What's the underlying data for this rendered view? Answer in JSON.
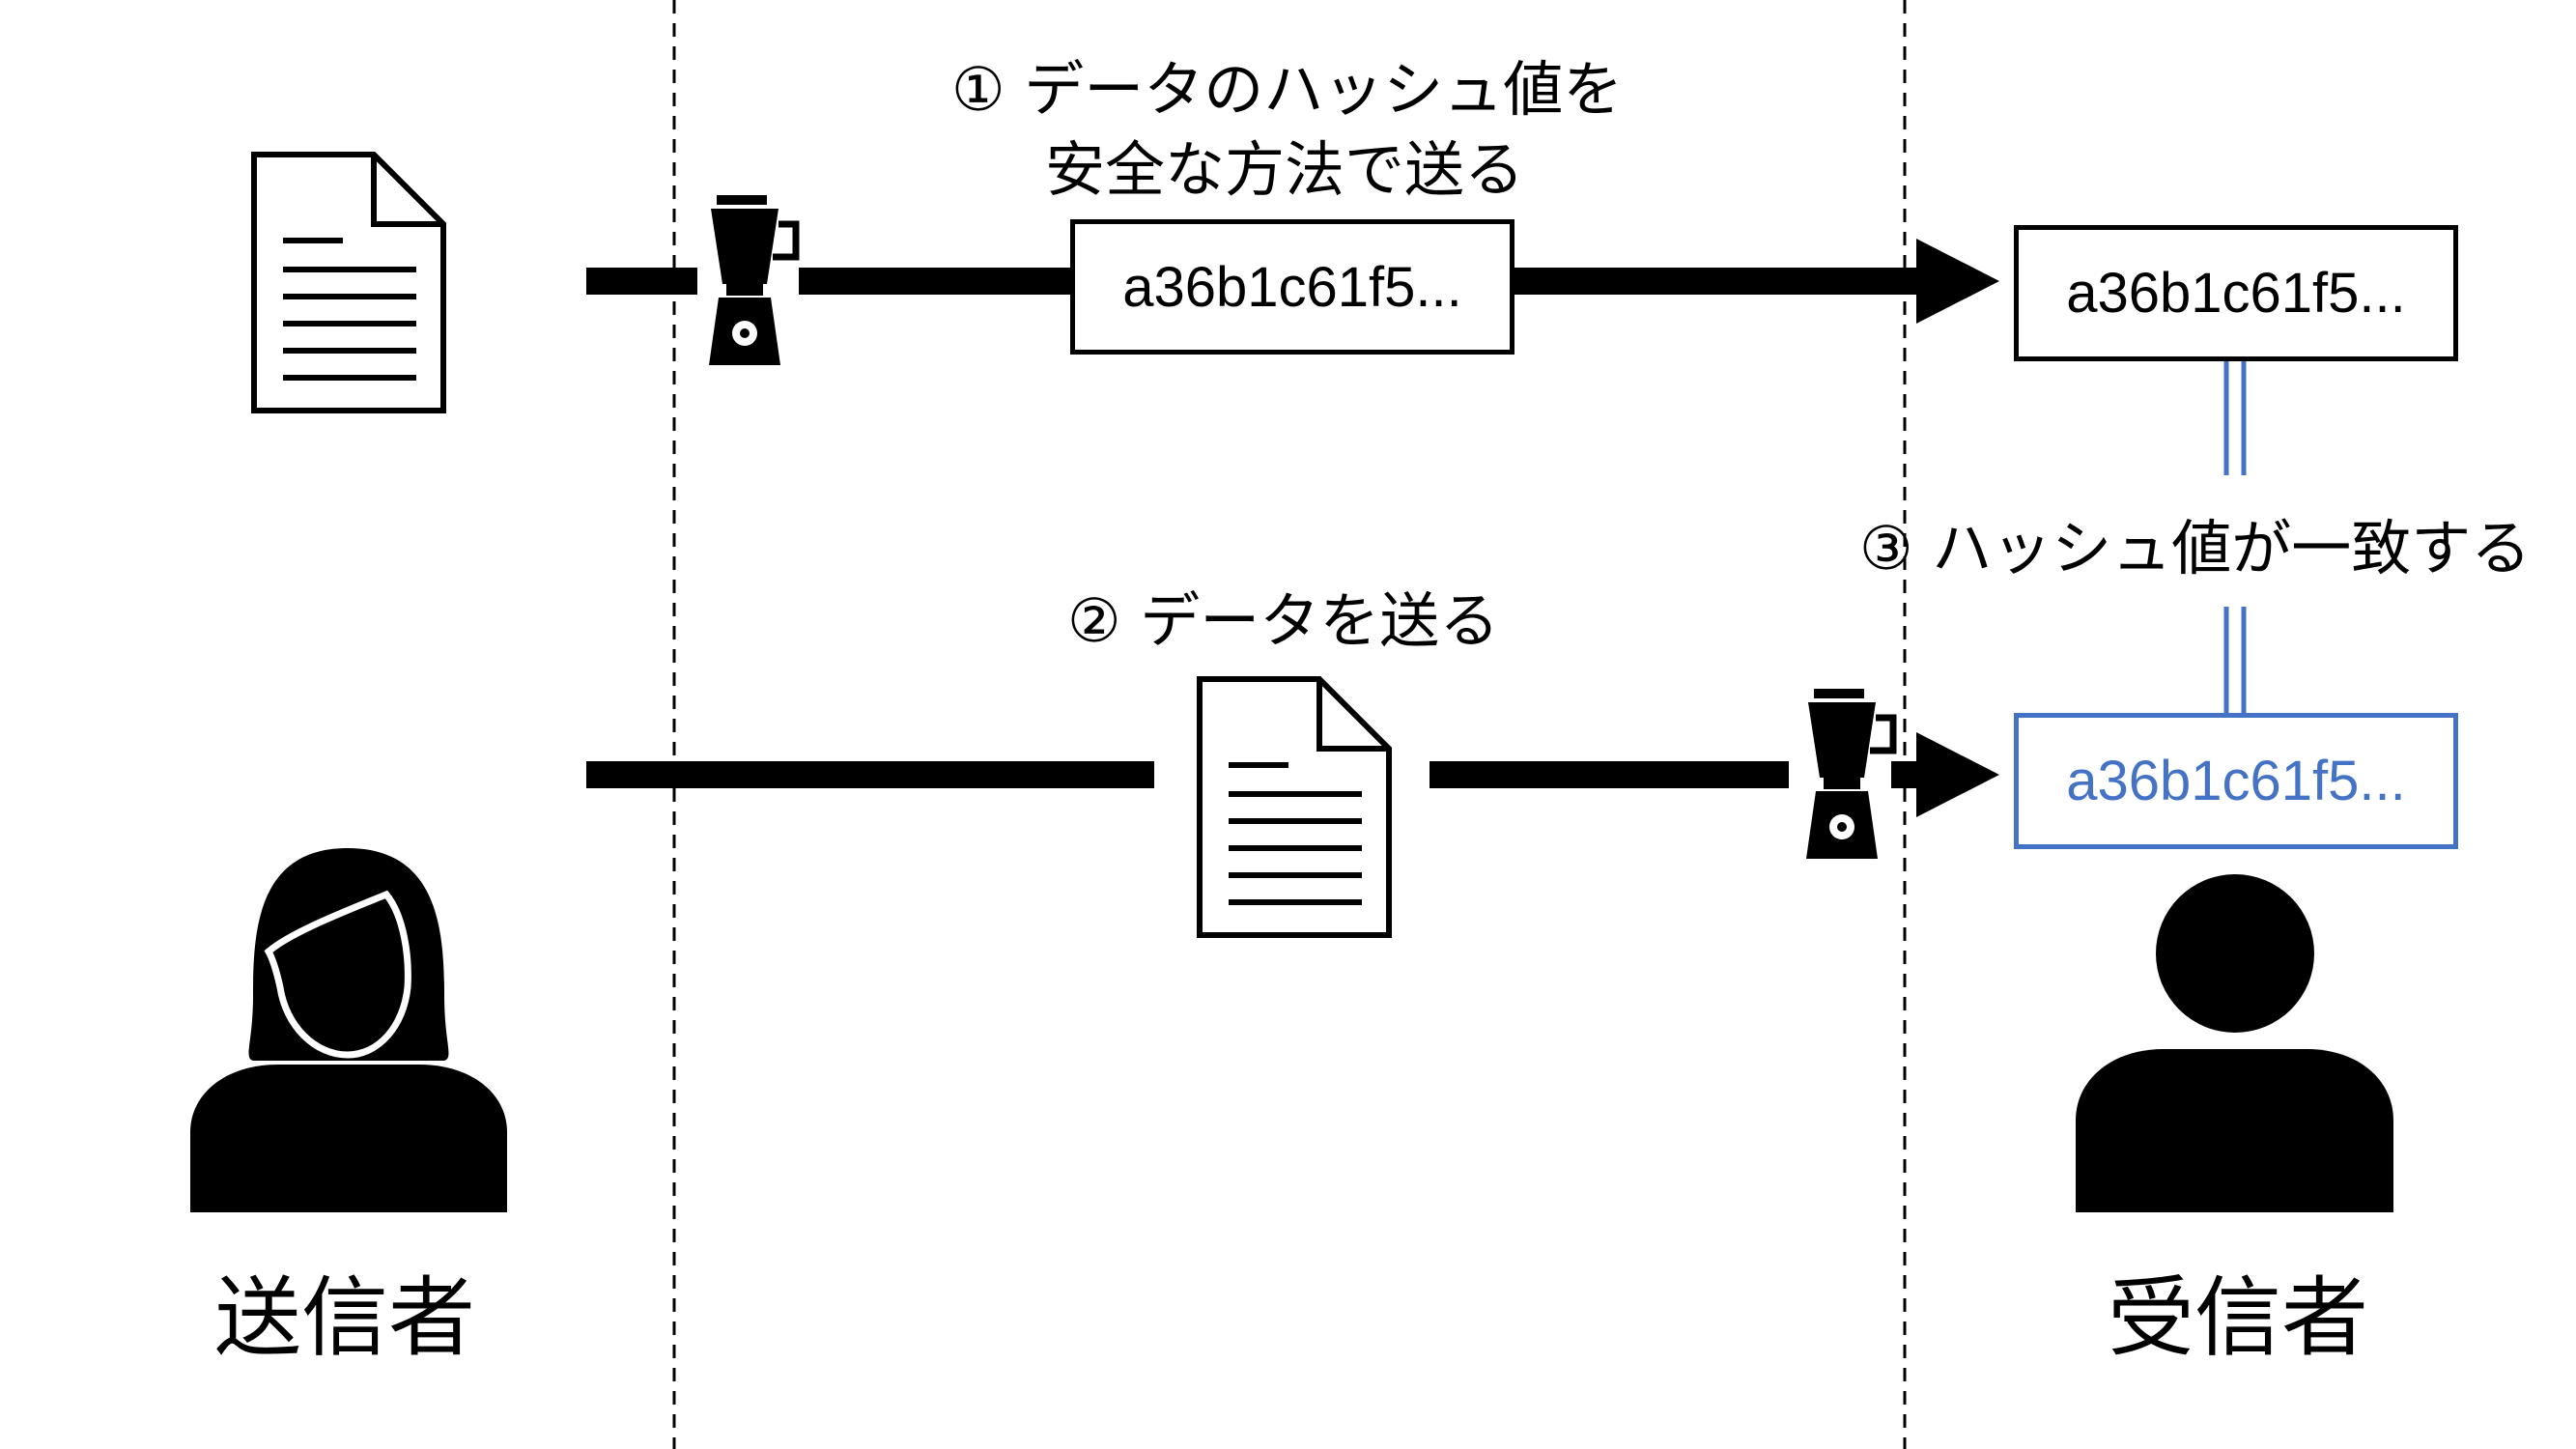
{
  "steps": {
    "step1_line1": "① データのハッシュ値を",
    "step1_line2": "安全な方法で送る",
    "step2": "② データを送る",
    "step3": "③ ハッシュ値が一致する"
  },
  "roles": {
    "sender": "送信者",
    "receiver": "受信者"
  },
  "hashes": {
    "sent_hash": "a36b1c61f5...",
    "received_hash": "a36b1c61f5...",
    "computed_hash": "a36b1c61f5..."
  },
  "colors": {
    "line": "#000000",
    "match": "#4472C4"
  },
  "icons": [
    "document-icon",
    "blender-icon",
    "person-icon"
  ]
}
